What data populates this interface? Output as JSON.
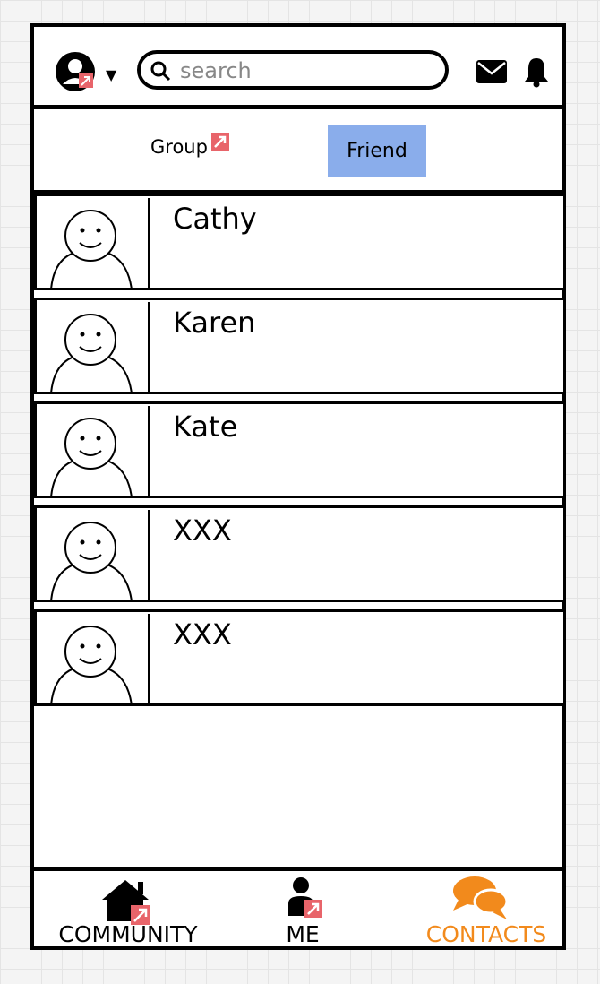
{
  "header": {
    "search": {
      "placeholder": "search",
      "value": "",
      "icon": "search-icon"
    },
    "icons": [
      "user-avatar-icon",
      "chevron-down-icon",
      "mail-icon",
      "bell-icon"
    ]
  },
  "tabs": [
    {
      "label": "Group",
      "active": false
    },
    {
      "label": "Friend",
      "active": true
    }
  ],
  "contacts": [
    {
      "name": "Cathy"
    },
    {
      "name": "Karen"
    },
    {
      "name": "Kate"
    },
    {
      "name": "XXX"
    },
    {
      "name": "XXX"
    }
  ],
  "bottom_nav": [
    {
      "label": "COMMUNITY",
      "icon": "home-icon",
      "active": false
    },
    {
      "label": "ME",
      "icon": "person-icon",
      "active": false
    },
    {
      "label": "CONTACTS",
      "icon": "chat-bubbles-icon",
      "active": true
    }
  ],
  "colors": {
    "active_tab": "#8aadeb",
    "active_nav": "#f28a1c",
    "link_badge": "#e8646a"
  }
}
